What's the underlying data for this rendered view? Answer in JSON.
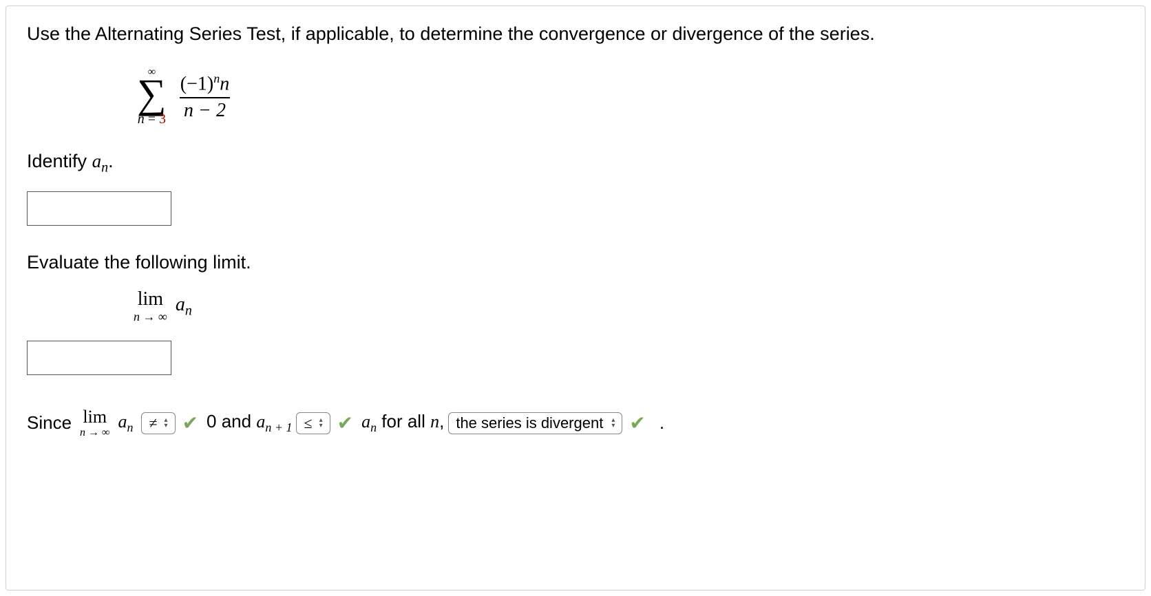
{
  "prompt": "Use the Alternating Series Test, if applicable, to determine the convergence or divergence of the series.",
  "series": {
    "upper": "∞",
    "lower_var": "n",
    "lower_eq": " = ",
    "lower_start": "3",
    "numerator_base": "(−1)",
    "numerator_exp": "n",
    "numerator_tail": "n",
    "denominator": "n − 2"
  },
  "identify": {
    "label_pre": "Identify ",
    "a": "a",
    "sub": "n",
    "label_post": "."
  },
  "evaluate_label": "Evaluate the following limit.",
  "limit": {
    "lim": "lim",
    "sub": "n → ∞",
    "a": "a",
    "an_sub": "n"
  },
  "conclusion": {
    "since": "Since",
    "lim": "lim",
    "limsub": "n → ∞",
    "a": "a",
    "an_sub": "n",
    "select1": "≠",
    "zero_and": "0 and ",
    "a2": "a",
    "an1_sub": "n + 1",
    "select2": "≤",
    "a3": "a",
    "an3_sub": "n",
    "for_all": " for all ",
    "n_it": "n",
    "comma": ", ",
    "select3": "the series is divergent",
    "period": "."
  },
  "icons": {
    "up": "▴",
    "down": "▾",
    "check": "✔"
  }
}
